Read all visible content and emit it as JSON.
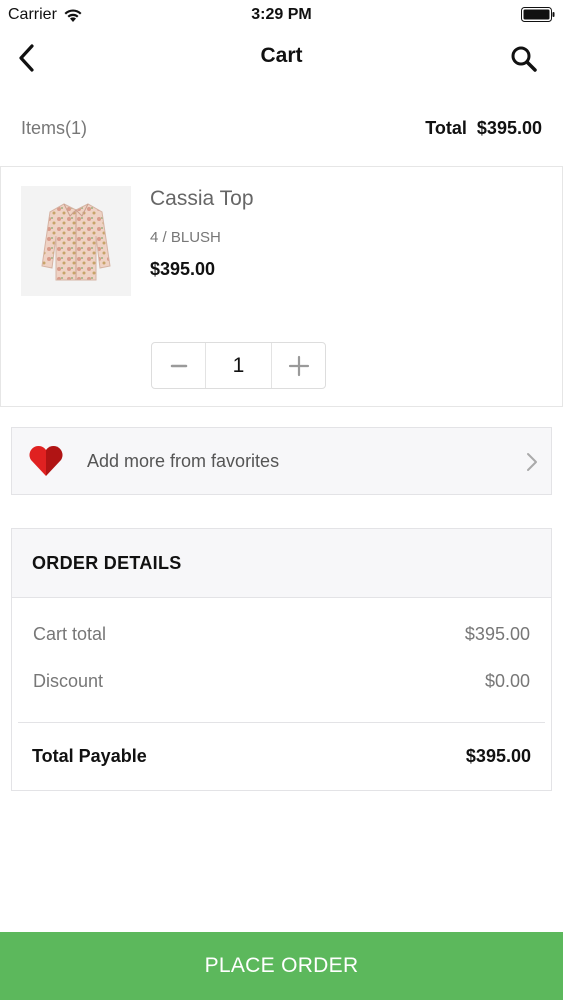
{
  "status_bar": {
    "carrier": "Carrier",
    "time": "3:29 PM",
    "icons": [
      "wifi-icon",
      "battery-icon"
    ]
  },
  "nav": {
    "title": "Cart",
    "back_icon": "chevron-left-icon",
    "search_icon": "search-icon"
  },
  "summary": {
    "items_label": "Items",
    "items_count": "(1)",
    "total_label": "Total",
    "total_value": "$395.00"
  },
  "cart_items": [
    {
      "name": "Cassia Top",
      "variant": "4 / BLUSH",
      "price": "$395.00",
      "quantity": "1",
      "minus_icon": "minus-icon",
      "plus_icon": "plus-icon"
    }
  ],
  "favorites": {
    "label": "Add more from favorites",
    "icon": "heart-icon",
    "chevron": "chevron-right-icon"
  },
  "order_details": {
    "title": "ORDER DETAILS",
    "lines": [
      {
        "label": "Cart total",
        "value": "$395.00"
      },
      {
        "label": "Discount",
        "value": "$0.00"
      }
    ],
    "total_label": "Total Payable",
    "total_value": "$395.00"
  },
  "place_order": {
    "label": "PLACE ORDER",
    "color": "#5cb85c"
  }
}
